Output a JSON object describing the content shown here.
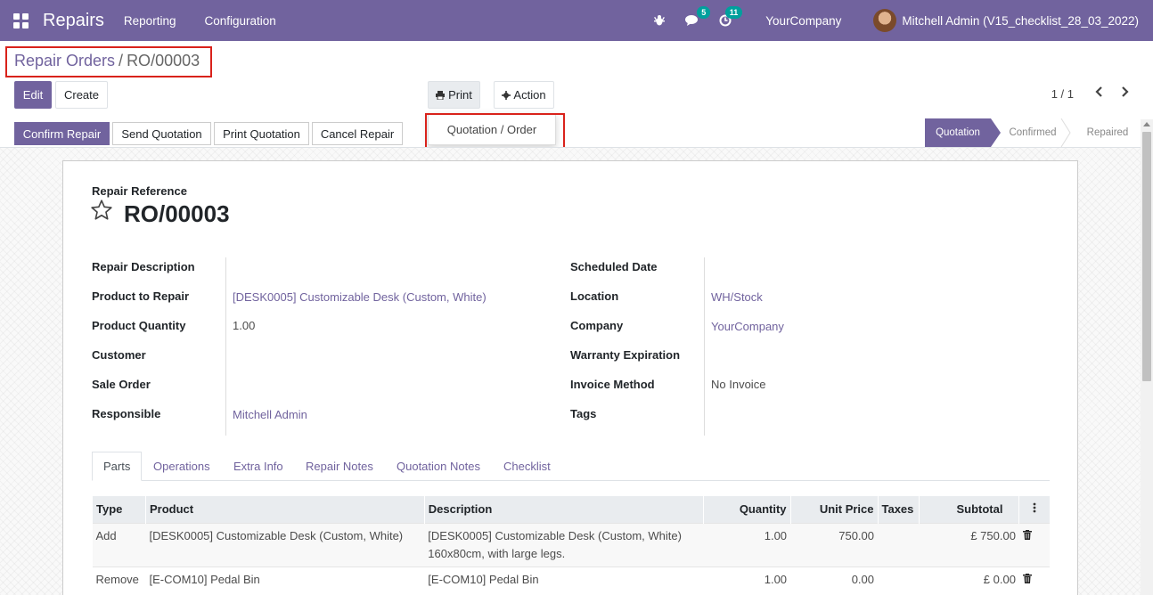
{
  "navbar": {
    "app_name": "Repairs",
    "menu": [
      "Reporting",
      "Configuration"
    ],
    "messages_count": "5",
    "activities_count": "11",
    "company": "YourCompany",
    "user": "Mitchell Admin (V15_checklist_28_03_2022)"
  },
  "breadcrumb": {
    "parent": "Repair Orders",
    "separator": "/",
    "current": "RO/00003"
  },
  "buttons": {
    "edit": "Edit",
    "create": "Create",
    "print": "Print",
    "action": "Action"
  },
  "print_menu": {
    "items": [
      "Quotation / Order"
    ]
  },
  "pager": {
    "value": "1 / 1"
  },
  "statusbar": {
    "buttons": [
      "Confirm Repair",
      "Send Quotation",
      "Print Quotation",
      "Cancel Repair"
    ],
    "stages": [
      "Quotation",
      "Confirmed",
      "Repaired"
    ],
    "active_stage": "Quotation"
  },
  "form": {
    "ref_label": "Repair Reference",
    "ref_name": "RO/00003",
    "left_fields": [
      {
        "label": "Repair Description",
        "value": ""
      },
      {
        "label": "Product to Repair",
        "value": "[DESK0005] Customizable Desk (Custom, White)"
      },
      {
        "label": "Product Quantity",
        "value": "1.00"
      },
      {
        "label": "Customer",
        "value": ""
      },
      {
        "label": "Sale Order",
        "value": ""
      },
      {
        "label": "Responsible",
        "value": "Mitchell Admin"
      }
    ],
    "right_fields": [
      {
        "label": "Scheduled Date",
        "value": ""
      },
      {
        "label": "Location",
        "value": "WH/Stock"
      },
      {
        "label": "Company",
        "value": "YourCompany"
      },
      {
        "label": "Warranty Expiration",
        "value": ""
      },
      {
        "label": "Invoice Method",
        "value": "No Invoice"
      },
      {
        "label": "Tags",
        "value": ""
      }
    ]
  },
  "tabs": [
    "Parts",
    "Operations",
    "Extra Info",
    "Repair Notes",
    "Quotation Notes",
    "Checklist"
  ],
  "table": {
    "headers": [
      "Type",
      "Product",
      "Description",
      "Quantity",
      "Unit Price",
      "Taxes",
      "Subtotal"
    ],
    "rows": [
      {
        "type": "Add",
        "product": "[DESK0005] Customizable Desk (Custom, White)",
        "description": "[DESK0005] Customizable Desk (Custom, White)",
        "description2": "160x80cm, with large legs.",
        "quantity": "1.00",
        "unit_price": "750.00",
        "taxes": "",
        "subtotal": "£ 750.00"
      },
      {
        "type": "Remove",
        "product": "[E-COM10] Pedal Bin",
        "description": "[E-COM10] Pedal Bin",
        "description2": "",
        "quantity": "1.00",
        "unit_price": "0.00",
        "taxes": "",
        "subtotal": "£ 0.00"
      }
    ]
  }
}
